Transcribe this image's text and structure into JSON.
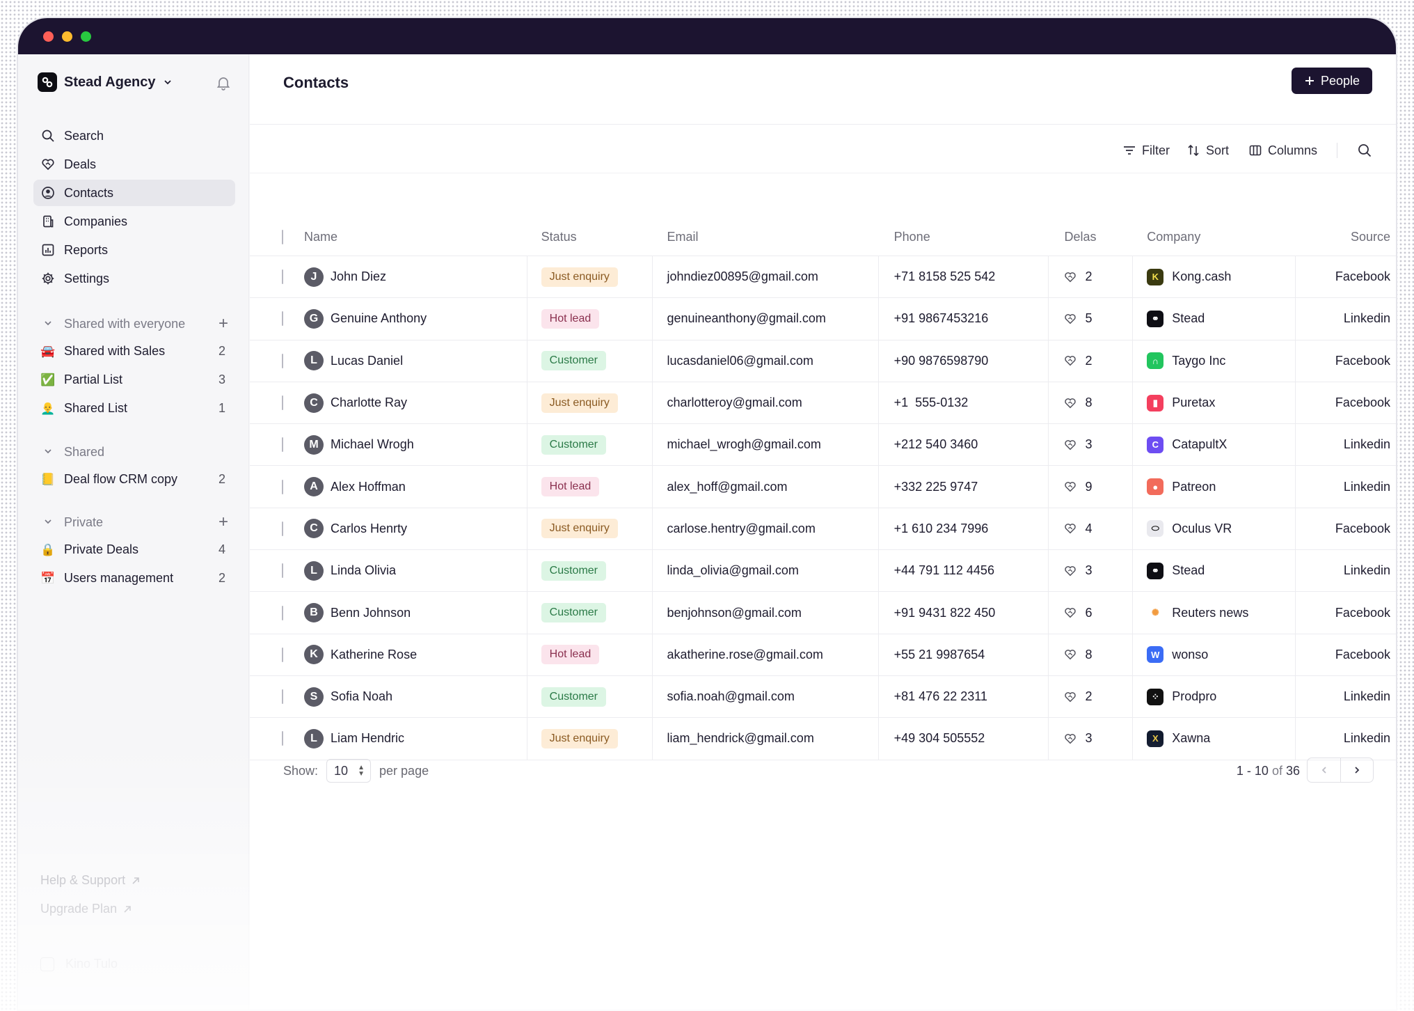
{
  "sidebar": {
    "workspace": "Stead Agency",
    "nav": [
      {
        "label": "Search",
        "icon": "search-icon"
      },
      {
        "label": "Deals",
        "icon": "deals-icon"
      },
      {
        "label": "Contacts",
        "icon": "contacts-icon",
        "active": true
      },
      {
        "label": "Companies",
        "icon": "companies-icon"
      },
      {
        "label": "Reports",
        "icon": "reports-icon"
      },
      {
        "label": "Settings",
        "icon": "gear-icon"
      }
    ],
    "sections": [
      {
        "title": "Shared with everyone",
        "items": [
          {
            "label": "Shared with Sales",
            "count": "2",
            "emoji": "🚘"
          },
          {
            "label": "Partial List",
            "count": "3",
            "emoji": "✅"
          },
          {
            "label": "Shared List",
            "count": "1",
            "emoji": "👨‍🦲"
          }
        ]
      },
      {
        "title": "Shared",
        "items": [
          {
            "label": "Deal flow CRM copy",
            "count": "2",
            "emoji": "📒"
          }
        ]
      },
      {
        "title": "Private",
        "items": [
          {
            "label": "Private Deals",
            "count": "4",
            "emoji": "🔒"
          },
          {
            "label": "Users management",
            "count": "2",
            "emoji": "📅"
          }
        ]
      }
    ],
    "help": "Help & Support",
    "upgrade": "Upgrade Plan",
    "user": "Kino Tulo"
  },
  "header": {
    "title": "Contacts",
    "people_button": "People"
  },
  "toolbar": {
    "filter": "Filter",
    "sort": "Sort",
    "columns": "Columns"
  },
  "table": {
    "columns": [
      "Name",
      "Status",
      "Email",
      "Phone",
      "Delas",
      "Company",
      "Source"
    ],
    "rows": [
      {
        "initial": "J",
        "name": "John Diez",
        "status": "Just enquiry",
        "email": "johndiez00895@gmail.com",
        "phone": "+71 8158 525 542",
        "deals": "2",
        "company": "Kong.cash",
        "source": "Facebook"
      },
      {
        "initial": "G",
        "name": "Genuine Anthony",
        "status": "Hot lead",
        "email": "genuineanthony@gmail.com",
        "phone": "+91 9867453216",
        "deals": "5",
        "company": "Stead",
        "source": "Linkedin"
      },
      {
        "initial": "L",
        "name": "Lucas Daniel",
        "status": "Customer",
        "email": "lucasdaniel06@gmail.com",
        "phone": "+90 9876598790",
        "deals": "2",
        "company": "Taygo Inc",
        "source": "Facebook"
      },
      {
        "initial": "C",
        "name": "Charlotte Ray",
        "status": "Just enquiry",
        "email": "charlotteroy@gmail.com",
        "phone": "+1  555-0132",
        "deals": "8",
        "company": "Puretax",
        "source": "Facebook"
      },
      {
        "initial": "M",
        "name": "Michael Wrogh",
        "status": "Customer",
        "email": "michael_wrogh@gmail.com",
        "phone": "+212 540 3460",
        "deals": "3",
        "company": "CatapultX",
        "source": "Linkedin"
      },
      {
        "initial": "A",
        "name": "Alex Hoffman",
        "status": "Hot lead",
        "email": "alex_hoff@gmail.com",
        "phone": "+332 225 9747",
        "deals": "9",
        "company": "Patreon",
        "source": "Linkedin"
      },
      {
        "initial": "C",
        "name": "Carlos Henrty",
        "status": "Just enquiry",
        "email": "carlose.hentry@gmail.com",
        "phone": "+1 610 234 7996",
        "deals": "4",
        "company": "Oculus VR",
        "source": "Facebook"
      },
      {
        "initial": "L",
        "name": "Linda Olivia",
        "status": "Customer",
        "email": "linda_olivia@gmail.com",
        "phone": "+44 791 112 4456",
        "deals": "3",
        "company": "Stead",
        "source": "Linkedin"
      },
      {
        "initial": "B",
        "name": "Benn Johnson",
        "status": "Customer",
        "email": "benjohnson@gmail.com",
        "phone": "+91 9431 822 450",
        "deals": "6",
        "company": "Reuters news",
        "source": "Facebook"
      },
      {
        "initial": "K",
        "name": "Katherine Rose",
        "status": "Hot lead",
        "email": "akatherine.rose@gmail.com",
        "phone": "+55 21 9987654",
        "deals": "8",
        "company": "wonso",
        "source": "Facebook"
      },
      {
        "initial": "S",
        "name": "Sofia Noah",
        "status": "Customer",
        "email": "sofia.noah@gmail.com",
        "phone": "+81 476 22 2311",
        "deals": "2",
        "company": "Prodpro",
        "source": "Linkedin"
      },
      {
        "initial": "L",
        "name": "Liam Hendric",
        "status": "Just enquiry",
        "email": "liam_hendrick@gmail.com",
        "phone": "+49 304 505552",
        "deals": "3",
        "company": "Xawna",
        "source": "Linkedin"
      }
    ]
  },
  "company_logos": {
    "Kong.cash": {
      "bg": "#3a3a10",
      "fg": "#f4e04d",
      "glyph": "K"
    },
    "Stead": {
      "bg": "#0e0e14",
      "fg": "#ffffff",
      "glyph": "⚭"
    },
    "Taygo Inc": {
      "bg": "#22c55e",
      "fg": "#ffffff",
      "glyph": "∩"
    },
    "Puretax": {
      "bg": "#f43f5e",
      "fg": "#ffffff",
      "glyph": "▮"
    },
    "CatapultX": {
      "bg": "#6d4df2",
      "fg": "#ffffff",
      "glyph": "C"
    },
    "Patreon": {
      "bg": "#f26b5b",
      "fg": "#ffffff",
      "glyph": "●"
    },
    "Oculus VR": {
      "bg": "#e9e9ee",
      "fg": "#111111",
      "glyph": "⬭"
    },
    "Reuters news": {
      "bg": "#ffffff",
      "fg": "#f29b3f",
      "glyph": "✺"
    },
    "wonso": {
      "bg": "#3b6cf5",
      "fg": "#ffffff",
      "glyph": "W"
    },
    "Prodpro": {
      "bg": "#111111",
      "fg": "#ffffff",
      "glyph": "⁘"
    },
    "Xawna": {
      "bg": "#111a2e",
      "fg": "#e6c64a",
      "glyph": "X"
    }
  },
  "status_colors": {
    "Just enquiry": "b-just",
    "Hot lead": "b-hot",
    "Customer": "b-cust"
  },
  "pagination": {
    "show_label": "Show:",
    "per_page_value": "10",
    "per_page_label": "per page",
    "range": "1 - 10",
    "of_label": "of",
    "total": "36"
  }
}
